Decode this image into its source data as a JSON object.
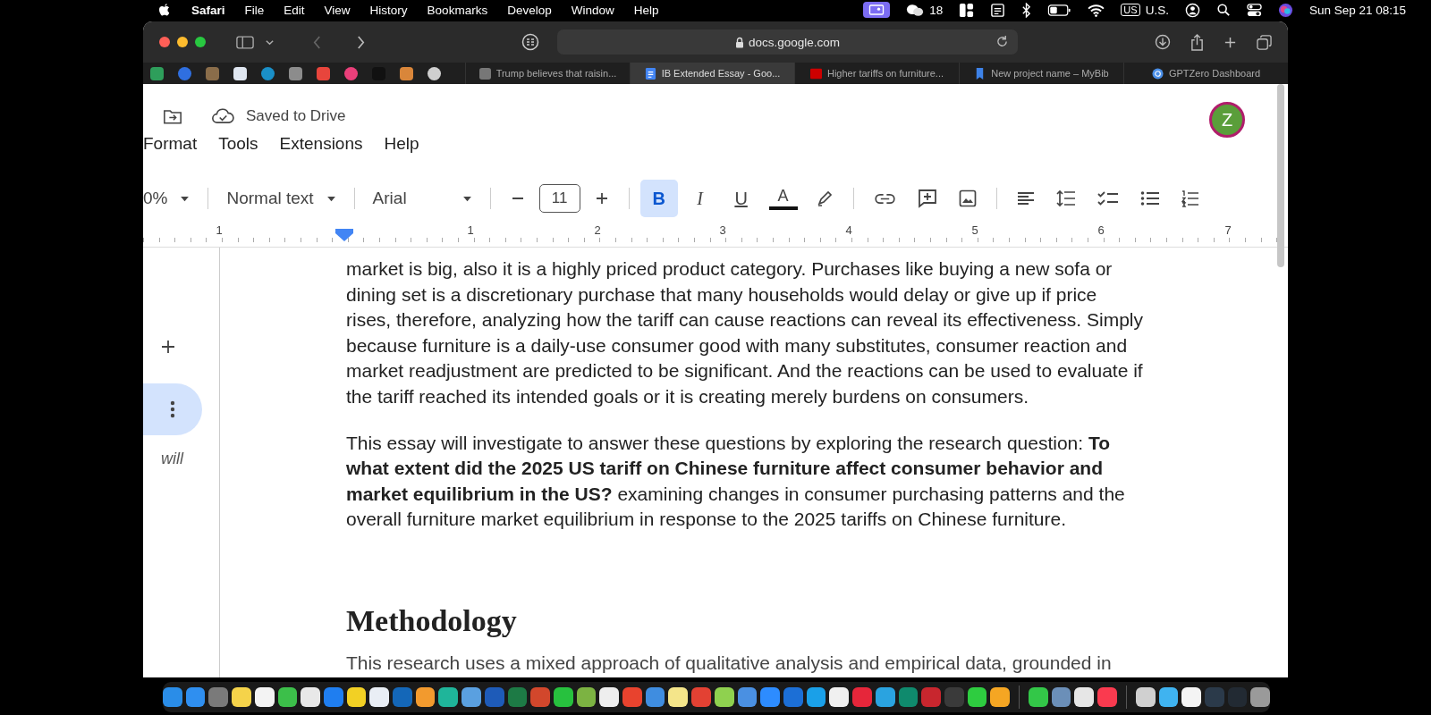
{
  "menu_bar": {
    "app": "Safari",
    "items": [
      "File",
      "Edit",
      "View",
      "History",
      "Bookmarks",
      "Develop",
      "Window",
      "Help"
    ],
    "wechat_count": "18",
    "input_badge": "US",
    "input_source": "U.S.",
    "clock": "Sun Sep 21  08:15"
  },
  "browser": {
    "address": "docs.google.com",
    "back_disabled": true,
    "pinned_tabs": [
      {
        "color": "#2e9e5b"
      },
      {
        "color": "#2f6fe0"
      },
      {
        "color": "#8a6d4a"
      },
      {
        "color": "#dfe6f0"
      },
      {
        "color": "#1a8fc7"
      },
      {
        "color": "#8c8c8c"
      },
      {
        "color": "#e8453c"
      },
      {
        "color": "#ea3f7a"
      },
      {
        "color": "#111111"
      },
      {
        "color": "#d9863a"
      },
      {
        "color": "#cfcfcf"
      }
    ],
    "tabs": [
      {
        "title": "Trump believes that raisin...",
        "selected": false
      },
      {
        "title": "IB Extended Essay - Goo...",
        "selected": true
      },
      {
        "title": "Higher tariffs on furniture...",
        "selected": false
      },
      {
        "title": "New project name – MyBib",
        "selected": false
      },
      {
        "title": "GPTZero Dashboard",
        "selected": false
      }
    ]
  },
  "docs": {
    "save_status": "Saved to Drive",
    "menu": [
      "Format",
      "Tools",
      "Extensions",
      "Help"
    ],
    "avatar": "Z",
    "toolbar": {
      "zoom": "0%",
      "style": "Normal text",
      "font": "Arial",
      "font_size": "11",
      "format_buttons": [
        {
          "label": "B",
          "selected": true
        },
        {
          "label": "I",
          "selected": false
        },
        {
          "label": "U",
          "selected": false
        }
      ],
      "text_color": "A"
    },
    "ruler": {
      "left_label": "1",
      "labels": [
        "1",
        "2",
        "3",
        "4",
        "5",
        "6",
        "7"
      ]
    },
    "side_note": "will",
    "paragraphs": [
      {
        "lines": [
          "market is big, also it is a highly priced product category. Purchases like buying a new sofa or",
          "dining set is a discretionary purchase that many households would delay or give up if price",
          "rises, therefore, analyzing how the tariff can cause reactions can reveal its effectiveness. Simply",
          "because furniture is a daily-use consumer good with many substitutes, consumer reaction and",
          "market readjustment are predicted to be significant. And the reactions can be used to evaluate if",
          "the tariff reached its intended goals or it is creating merely burdens on consumers."
        ]
      },
      {
        "lines": [
          "This essay will investigate to answer these questions by exploring the research question: **To**",
          "**what extent did the 2025 US tariff on Chinese furniture affect consumer behavior and**",
          "**market equilibrium in the US?** examining changes in consumer purchasing patterns and the",
          "overall furniture market equilibrium in response to the 2025 tariffs on Chinese furniture."
        ]
      }
    ],
    "heading": "Methodology",
    "next_line": "This research uses a mixed approach of qualitative analysis and empirical data, grounded in"
  },
  "dock": {
    "groups": [
      [
        {
          "color": "#2a8de8"
        },
        {
          "color": "#2f8ff0"
        },
        {
          "color": "#7a7a7a"
        },
        {
          "color": "#f5d34a"
        },
        {
          "color": "#f3f3f3"
        },
        {
          "color": "#3cbf4a"
        },
        {
          "color": "#e8e8e8"
        },
        {
          "color": "#1f7ef0"
        },
        {
          "color": "#f2d024"
        },
        {
          "color": "#e9eef5"
        },
        {
          "color": "#1467b8"
        },
        {
          "color": "#f29a2e"
        },
        {
          "color": "#1fb59a"
        },
        {
          "color": "#5aa0e0"
        },
        {
          "color": "#1e5bb8"
        },
        {
          "color": "#1d7a45"
        },
        {
          "color": "#d2472c"
        },
        {
          "color": "#27c13e"
        },
        {
          "color": "#7cb342"
        },
        {
          "color": "#eeeeee"
        },
        {
          "color": "#e8432e"
        },
        {
          "color": "#3f8de0"
        },
        {
          "color": "#f4e58a"
        },
        {
          "color": "#e34133"
        },
        {
          "color": "#8fd14f"
        },
        {
          "color": "#4a90e2"
        },
        {
          "color": "#2d8cff"
        },
        {
          "color": "#1c6fd6"
        },
        {
          "color": "#1aa0e8"
        },
        {
          "color": "#f0f0f0"
        },
        {
          "color": "#e6263a"
        },
        {
          "color": "#2aa3e0"
        },
        {
          "color": "#0f8a6d"
        },
        {
          "color": "#c8262e"
        },
        {
          "color": "#3a3a3a"
        },
        {
          "color": "#2ecc40"
        },
        {
          "color": "#f5a623"
        }
      ],
      [
        {
          "color": "#33c748"
        },
        {
          "color": "#6b8fb8"
        },
        {
          "color": "#e6e6e6"
        },
        {
          "color": "#fa3a4f"
        }
      ],
      [
        {
          "color": "#d0d0d0"
        },
        {
          "color": "#3fb3f0"
        },
        {
          "color": "#f4f4f4"
        },
        {
          "color": "#2b3a4a"
        },
        {
          "color": "#222a33"
        },
        {
          "color": "#9a9a9a"
        }
      ]
    ]
  }
}
